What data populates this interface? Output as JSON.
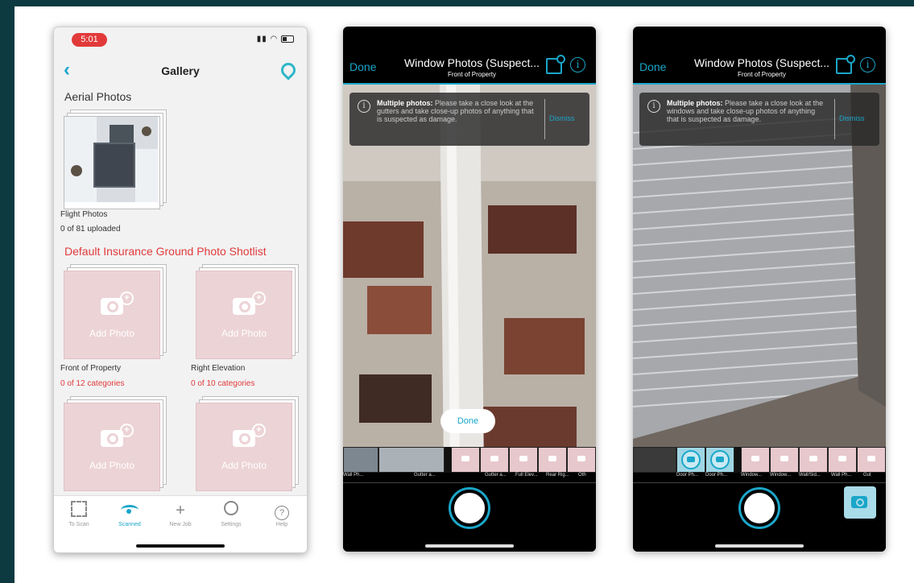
{
  "gallery": {
    "status_time": "5:01",
    "nav_title": "Gallery",
    "aerial_section_title": "Aerial Photos",
    "flight_photos_label": "Flight Photos",
    "flight_photos_count": "0 of 81 uploaded",
    "shotlist_title": "Default Insurance Ground Photo Shotlist",
    "add_photo_label": "Add Photo",
    "tiles": [
      {
        "label": "Front of Property",
        "count": "0 of 12 categories"
      },
      {
        "label": "Right Elevation",
        "count": "0 of 10 categories"
      }
    ],
    "tabbar": [
      {
        "label": "To Scan",
        "icon": "scan-icon"
      },
      {
        "label": "Scanned",
        "icon": "scanned-icon"
      },
      {
        "label": "New Job",
        "icon": "plus-icon"
      },
      {
        "label": "Settings",
        "icon": "gear-icon"
      },
      {
        "label": "Help",
        "icon": "help-icon"
      }
    ],
    "active_tab": "Scanned"
  },
  "camera1": {
    "done_label": "Done",
    "title": "Window Photos (Suspect...",
    "subtitle": "Front of Property",
    "banner_bold": "Multiple photos:",
    "banner_text": " Please take a close look at the gutters and take close-up photos of anything that is suspected as damage.",
    "banner_dismiss": "Dismiss",
    "floating_done": "Done",
    "thumb_labels": [
      "Wall Ph...",
      "Gutter a...",
      "Gutter a...",
      "Full Elev...",
      "Rear Rig...",
      "Oth"
    ]
  },
  "camera2": {
    "done_label": "Done",
    "title": "Window Photos (Suspect...",
    "subtitle": "Front of Property",
    "banner_bold": "Multiple photos:",
    "banner_text": " Please take a close look at the windows and take close-up photos of anything that is suspected as damage.",
    "banner_dismiss": "Dismiss",
    "thumb_labels": [
      "Door Ph...",
      "Door Ph...",
      "Window...",
      "Window...",
      "Wall/Sid...",
      "Wall Ph...",
      "Gut"
    ]
  },
  "colors": {
    "accent": "#1aa6c9",
    "alert_red": "#e23a3a",
    "frame_background": "#0c3a40"
  }
}
